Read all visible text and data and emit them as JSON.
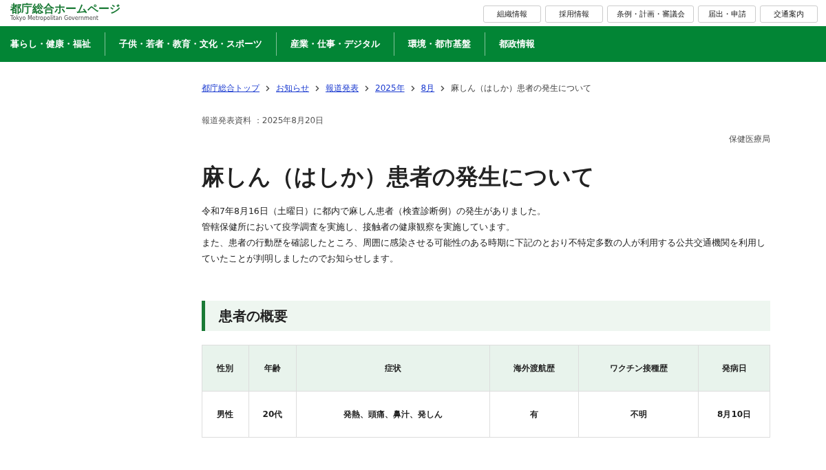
{
  "site": {
    "title": "都庁総合ホームページ",
    "subtitle": "Tokyo Metropolitan Government"
  },
  "utility_links": [
    "組織情報",
    "採用情報",
    "条例・計画・審議会",
    "届出・申請",
    "交通案内"
  ],
  "nav": [
    "暮らし・健康・福祉",
    "子供・若者・教育・文化・スポーツ",
    "産業・仕事・デジタル",
    "環境・都市基盤",
    "都政情報"
  ],
  "breadcrumb": [
    {
      "label": "都庁総合トップ",
      "link": true
    },
    {
      "label": "お知らせ",
      "link": true
    },
    {
      "label": "報道発表",
      "link": true
    },
    {
      "label": "2025年",
      "link": true
    },
    {
      "label": "8月",
      "link": true
    },
    {
      "label": "麻しん（はしか）患者の発生について",
      "link": false
    }
  ],
  "release_date": "報道発表資料 ：2025年8月20日",
  "department": "保健医療局",
  "title": "麻しん（はしか）患者の発生について",
  "paragraphs": [
    "令和7年8月16日（土曜日）に都内で麻しん患者（検査診断例）の発生がありました。",
    "管轄保健所において疫学調査を実施し、接触者の健康観察を実施しています。",
    "また、患者の行動歴を確認したところ、周囲に感染させる可能性のある時期に下記のとおり不特定多数の人が利用する公共交通機関を利用していたことが判明しましたのでお知らせします。"
  ],
  "section_heading": "患者の概要",
  "table": {
    "columns": [
      "性別",
      "年齢",
      "症状",
      "海外渡航歴",
      "ワクチン接種歴",
      "発病日"
    ],
    "rows": [
      [
        "男性",
        "20代",
        "発熱、頭痛、鼻汁、発しん",
        "有",
        "不明",
        "8月10日"
      ]
    ]
  }
}
